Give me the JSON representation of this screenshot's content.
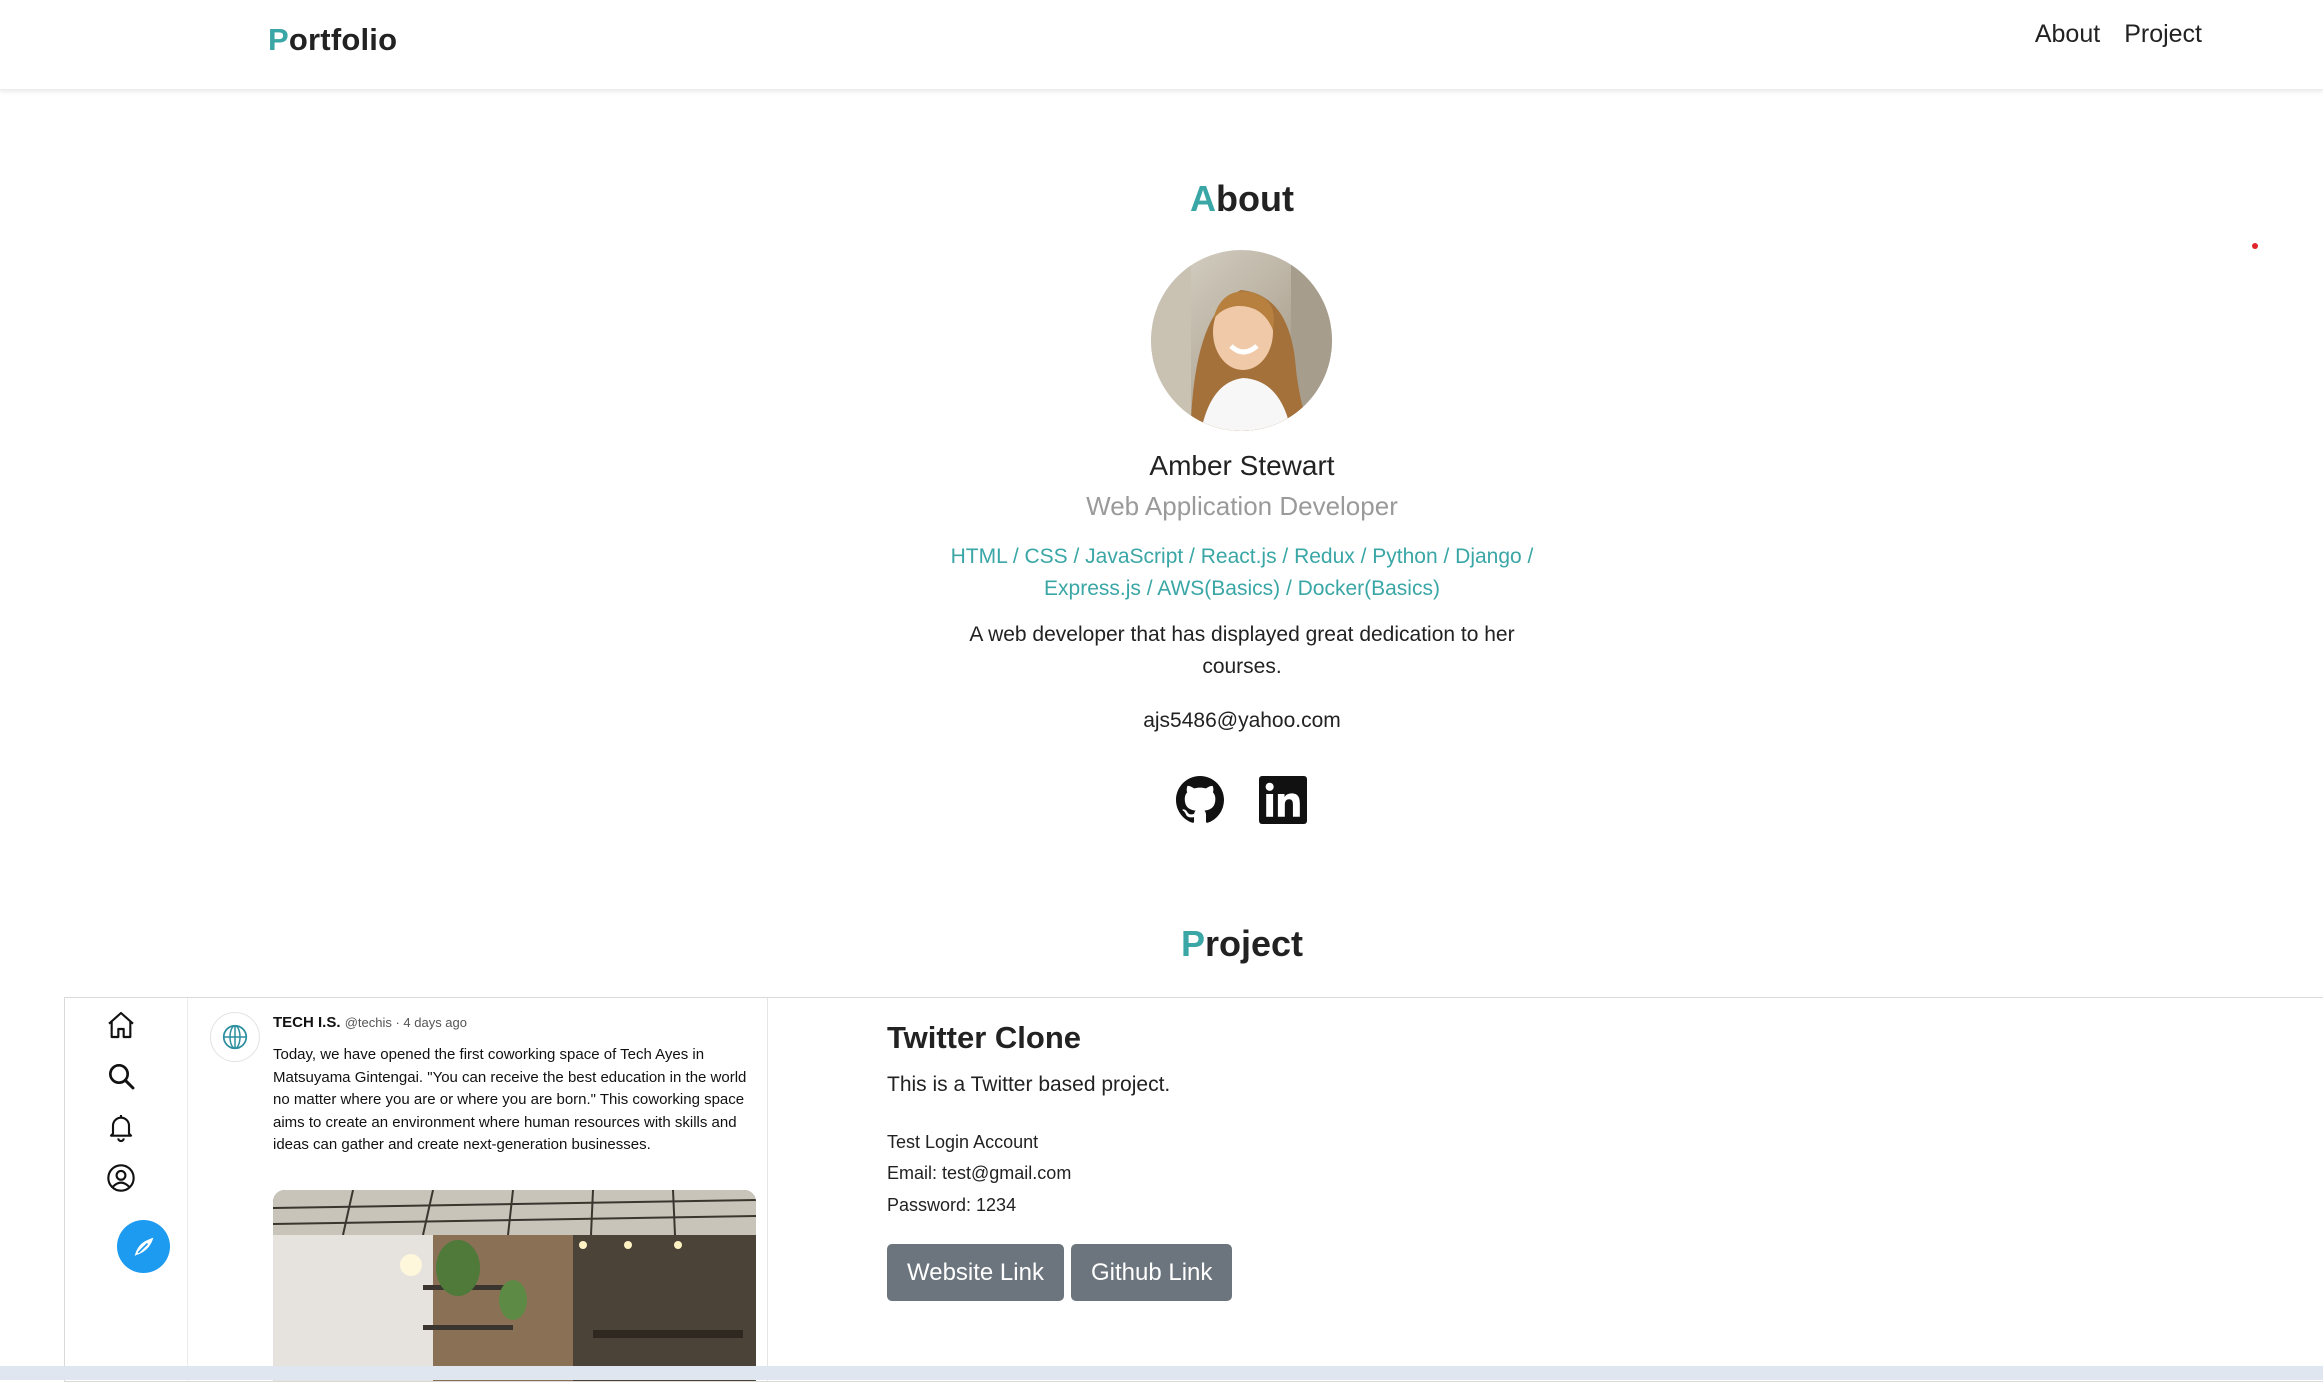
{
  "navbar": {
    "brand_first": "P",
    "brand_rest": "ortfolio",
    "links": [
      "About",
      "Project"
    ]
  },
  "about": {
    "heading_first": "A",
    "heading_rest": "bout",
    "name": "Amber Stewart",
    "role": "Web Application Developer",
    "skills": "HTML / CSS / JavaScript / React.js / Redux / Python / Django / Express.js / AWS(Basics) / Docker(Basics)",
    "bio": "A web developer that has displayed great dedication to her courses.",
    "email": "ajs5486@yahoo.com",
    "social_icons": [
      "github-icon",
      "linkedin-icon"
    ]
  },
  "project": {
    "heading_first": "P",
    "heading_rest": "roject",
    "title": "Twitter Clone",
    "description": "This is a Twitter based project.",
    "login_heading": "Test Login Account",
    "email_line": "Email: test@gmail.com",
    "password_line": "Password: 1234",
    "buttons": [
      "Website Link",
      "Github Link"
    ],
    "preview": {
      "sidebar_icons": [
        "home-icon",
        "search-icon",
        "bell-icon",
        "profile-icon",
        "compose-icon"
      ],
      "tweet_author": "TECH I.S.",
      "tweet_meta": "@techis · 4 days ago",
      "tweet_text": "Today, we have opened the first coworking space of Tech Ayes in Matsuyama Gintengai. \"You can receive the best education in the world no matter where you are or where you are born.\" This coworking space aims to create an environment where human resources with skills and ideas can gather and create next-generation businesses."
    }
  },
  "colors": {
    "accent": "#3aa6a6",
    "button": "#6c757d",
    "twitter_blue": "#1d9bf0"
  }
}
